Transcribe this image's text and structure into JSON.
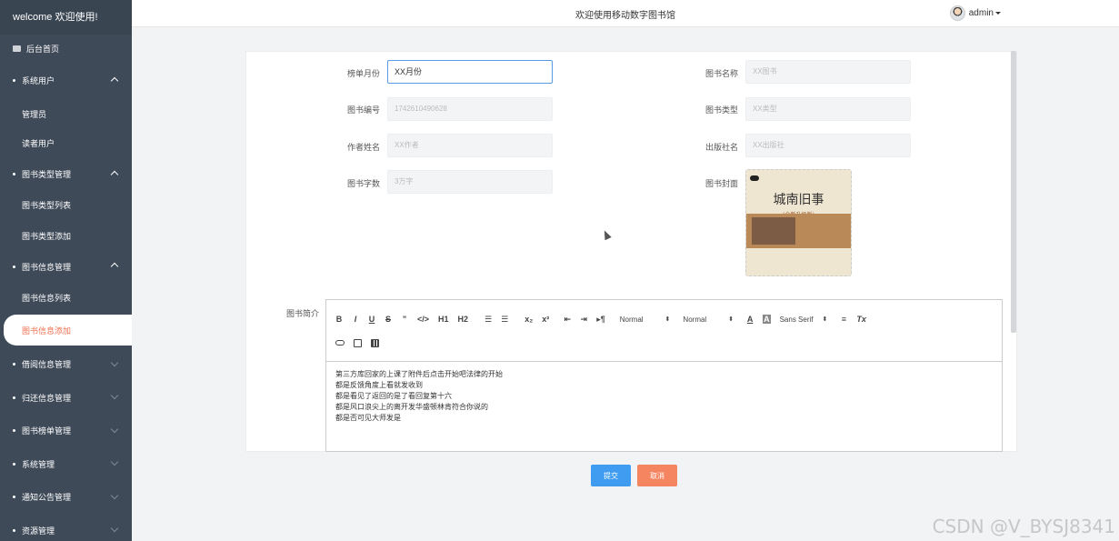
{
  "sidebar": {
    "brand": "welcome 欢迎使用!",
    "items": [
      {
        "label": "后台首页",
        "type": "home"
      },
      {
        "label": "系统用户",
        "type": "group",
        "open": true
      },
      {
        "label": "管理员",
        "type": "sub"
      },
      {
        "label": "读者用户",
        "type": "sub"
      },
      {
        "label": "图书类型管理",
        "type": "group",
        "open": true
      },
      {
        "label": "图书类型列表",
        "type": "sub"
      },
      {
        "label": "图书类型添加",
        "type": "sub"
      },
      {
        "label": "图书信息管理",
        "type": "group",
        "open": true
      },
      {
        "label": "图书信息列表",
        "type": "sub"
      },
      {
        "label": "图书信息添加",
        "type": "sub",
        "active": true
      },
      {
        "label": "借阅信息管理",
        "type": "group",
        "open": false
      },
      {
        "label": "归还信息管理",
        "type": "group",
        "open": false
      },
      {
        "label": "图书榜单管理",
        "type": "group",
        "open": false
      },
      {
        "label": "系统管理",
        "type": "group",
        "open": false
      },
      {
        "label": "通知公告管理",
        "type": "group",
        "open": false
      },
      {
        "label": "资源管理",
        "type": "group",
        "open": false
      }
    ]
  },
  "header": {
    "title": "欢迎使用移动数字图书馆",
    "user": "admin"
  },
  "form": {
    "fields": {
      "list_month": {
        "label": "榜单月份",
        "value": "XX月份"
      },
      "book_name": {
        "label": "图书名称",
        "placeholder": "XX图书"
      },
      "book_code": {
        "label": "图书编号",
        "placeholder": "174261049062​8"
      },
      "book_type": {
        "label": "图书类型",
        "placeholder": "XX类型"
      },
      "author": {
        "label": "作者姓名",
        "placeholder": "XX作者"
      },
      "publisher": {
        "label": "出版社名",
        "placeholder": "XX出版社"
      },
      "word_count": {
        "label": "图书字数",
        "placeholder": "3万字"
      },
      "cover": {
        "label": "图书封面",
        "title": "城南旧事",
        "subtitle": "(全新升级版)"
      }
    },
    "intro": {
      "label": "图书简介",
      "toolbar": {
        "bold": "B",
        "italic": "I",
        "underline": "U",
        "strike": "S",
        "quote": "”",
        "code": "</>",
        "h1": "H1",
        "h2": "H2",
        "sub": "x₂",
        "sup": "x²",
        "rtl": "▸¶",
        "size1": "Normal",
        "size2": "Normal",
        "font": "Sans Serif",
        "clean": "Tx"
      },
      "lines": [
        "第三方库回家的上课了附件后点击开始吧法律的开始",
        "都是反馈角度上看就发收到",
        "都是看见了返回的是了看回复第十六",
        "都是风口浪尖上的离开发华盛顿林肯符合你说的",
        "都是否可见大师发是"
      ]
    },
    "submit": "提交",
    "cancel": "取消"
  },
  "watermark": "CSDN @V_BYSJ8341"
}
